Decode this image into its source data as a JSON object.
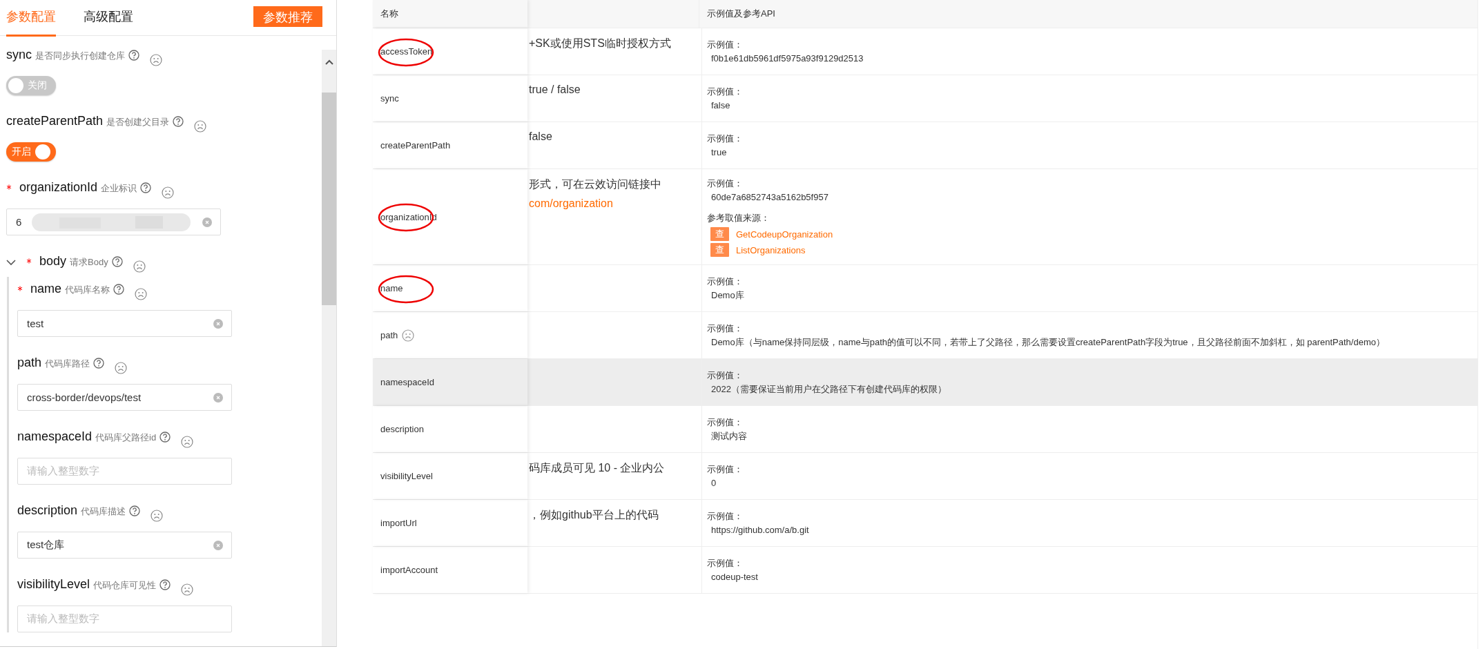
{
  "panel": {
    "tabs": [
      {
        "label": "参数配置",
        "selected": true
      },
      {
        "label": "高级配置",
        "selected": false
      }
    ],
    "recommend_button": "参数推荐",
    "params": [
      {
        "kind": "toggle",
        "name": "sync",
        "desc": "是否同步执行创建仓库",
        "required": false,
        "on": false,
        "toggle_label": "关闭"
      },
      {
        "kind": "toggle",
        "name": "createParentPath",
        "desc": "是否创建父目录",
        "required": false,
        "on": true,
        "toggle_label": "开启"
      },
      {
        "kind": "input",
        "name": "organizationId",
        "desc": "企业标识",
        "required": true,
        "value": "6",
        "redacted": true
      },
      {
        "kind": "group",
        "name": "body",
        "desc": "请求Body",
        "required": true,
        "expanded": true,
        "children": [
          {
            "name": "name",
            "desc": "代码库名称",
            "required": true,
            "value": "test"
          },
          {
            "name": "path",
            "desc": "代码库路径",
            "required": false,
            "value": "cross-border/devops/test"
          },
          {
            "name": "namespaceId",
            "desc": "代码库父路径id",
            "required": false,
            "placeholder": "请输入整型数字"
          },
          {
            "name": "description",
            "desc": "代码库描述",
            "required": false,
            "value": "test仓库"
          },
          {
            "name": "visibilityLevel",
            "desc": "代码仓库可见性",
            "required": false,
            "placeholder": "请输入整型数字"
          }
        ]
      }
    ]
  },
  "table": {
    "columns": [
      "名称",
      "示例值及参考API"
    ],
    "rows": [
      {
        "name": "accessToken",
        "circled": true,
        "highlighted": false,
        "feedback_icon": false,
        "description": "+SK或使用STS临时授权方式",
        "example_label": "示例值：",
        "example": "f0b1e61db5961df5975a93f9129d2513"
      },
      {
        "name": "sync",
        "circled": false,
        "highlighted": false,
        "feedback_icon": false,
        "description": "true / false",
        "example_label": "示例值：",
        "example": "false"
      },
      {
        "name": "createParentPath",
        "circled": false,
        "highlighted": false,
        "feedback_icon": false,
        "description": "false",
        "example_label": "示例值：",
        "example": "true"
      },
      {
        "name": "organizationId",
        "circled": true,
        "highlighted": false,
        "feedback_icon": false,
        "description": "形式，可在云效访问链接中",
        "link": "com/organization",
        "example_label": "示例值：",
        "example": "60de7a6852743a5162b5f957",
        "source_label": "参考取值来源：",
        "sources": [
          {
            "badge": "查",
            "api": "GetCodeupOrganization"
          },
          {
            "badge": "查",
            "api": "ListOrganizations"
          }
        ]
      },
      {
        "name": "name",
        "circled": true,
        "highlighted": false,
        "feedback_icon": false,
        "example_label": "示例值：",
        "example": "Demo库"
      },
      {
        "name": "path",
        "circled": false,
        "highlighted": false,
        "feedback_icon": true,
        "example_label": "示例值：",
        "example": "Demo库（与name保持同层级，name与path的值可以不同，若带上了父路径，那么需要设置createParentPath字段为true，且父路径前面不加斜杠，如 parentPath/demo）"
      },
      {
        "name": "namespaceId",
        "circled": false,
        "highlighted": true,
        "feedback_icon": false,
        "example_label": "示例值：",
        "example": "2022（需要保证当前用户在父路径下有创建代码库的权限）"
      },
      {
        "name": "description",
        "circled": false,
        "highlighted": false,
        "feedback_icon": false,
        "example_label": "示例值：",
        "example": "测试内容"
      },
      {
        "name": "visibilityLevel",
        "circled": false,
        "highlighted": false,
        "feedback_icon": false,
        "description": "码库成员可见 10 - 企业内公",
        "example_label": "示例值：",
        "example": "0"
      },
      {
        "name": "importUrl",
        "circled": false,
        "highlighted": false,
        "feedback_icon": false,
        "description": "，例如github平台上的代码",
        "example_label": "示例值：",
        "example": "https://github.com/a/b.git"
      },
      {
        "name": "importAccount",
        "circled": false,
        "highlighted": false,
        "feedback_icon": false,
        "example_label": "示例值：",
        "example": "codeup-test"
      }
    ]
  }
}
